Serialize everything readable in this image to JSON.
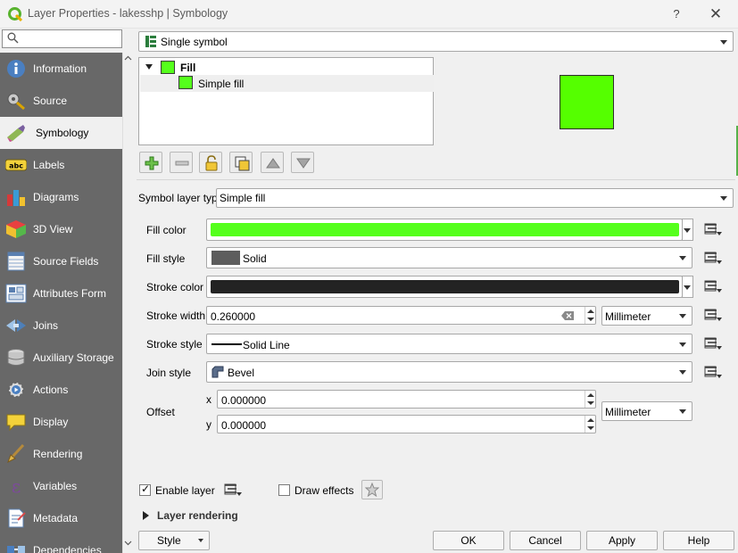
{
  "window": {
    "title": "Layer Properties - lakesshp | Symbology",
    "help_glyph": "?",
    "close_glyph": "✕"
  },
  "search": {
    "placeholder": "",
    "icon": "search-icon"
  },
  "sidebar": {
    "items": [
      {
        "label": "Information",
        "icon": "information-icon"
      },
      {
        "label": "Source",
        "icon": "source-icon"
      },
      {
        "label": "Symbology",
        "icon": "symbology-icon",
        "active": true
      },
      {
        "label": "Labels",
        "icon": "labels-icon"
      },
      {
        "label": "Diagrams",
        "icon": "diagrams-icon"
      },
      {
        "label": "3D View",
        "icon": "3d-view-icon"
      },
      {
        "label": "Source Fields",
        "icon": "source-fields-icon"
      },
      {
        "label": "Attributes Form",
        "icon": "attributes-form-icon"
      },
      {
        "label": "Joins",
        "icon": "joins-icon"
      },
      {
        "label": "Auxiliary Storage",
        "icon": "auxiliary-storage-icon"
      },
      {
        "label": "Actions",
        "icon": "actions-icon"
      },
      {
        "label": "Display",
        "icon": "display-icon"
      },
      {
        "label": "Rendering",
        "icon": "rendering-icon"
      },
      {
        "label": "Variables",
        "icon": "variables-icon"
      },
      {
        "label": "Metadata",
        "icon": "metadata-icon"
      },
      {
        "label": "Dependencies",
        "icon": "dependencies-icon"
      }
    ]
  },
  "renderer": {
    "selected": "Single symbol"
  },
  "tree": {
    "fill_label": "Fill",
    "simple_fill_label": "Simple fill",
    "swatch_color": "#55ff1c"
  },
  "preview": {
    "color": "#55ff00"
  },
  "symbol_layer_type": {
    "label": "Symbol layer type",
    "selected": "Simple fill"
  },
  "properties": {
    "fill_color": {
      "label": "Fill color",
      "color": "#55ff1c"
    },
    "fill_style": {
      "label": "Fill style",
      "value": "Solid"
    },
    "stroke_color": {
      "label": "Stroke color",
      "color": "#232323"
    },
    "stroke_width": {
      "label": "Stroke width",
      "value": "0.260000",
      "unit": "Millimeter"
    },
    "stroke_style": {
      "label": "Stroke style",
      "value": "Solid Line"
    },
    "join_style": {
      "label": "Join style",
      "value": "Bevel"
    },
    "offset": {
      "label": "Offset",
      "x_label": "x",
      "x_value": "0.000000",
      "y_label": "y",
      "y_value": "0.000000",
      "unit": "Millimeter"
    }
  },
  "bottom": {
    "enable_layer_label": "Enable layer",
    "enable_layer_checked": true,
    "draw_effects_label": "Draw effects",
    "draw_effects_checked": false,
    "layer_rendering_label": "Layer rendering"
  },
  "buttons": {
    "style": "Style",
    "ok": "OK",
    "cancel": "Cancel",
    "apply": "Apply",
    "help": "Help"
  }
}
